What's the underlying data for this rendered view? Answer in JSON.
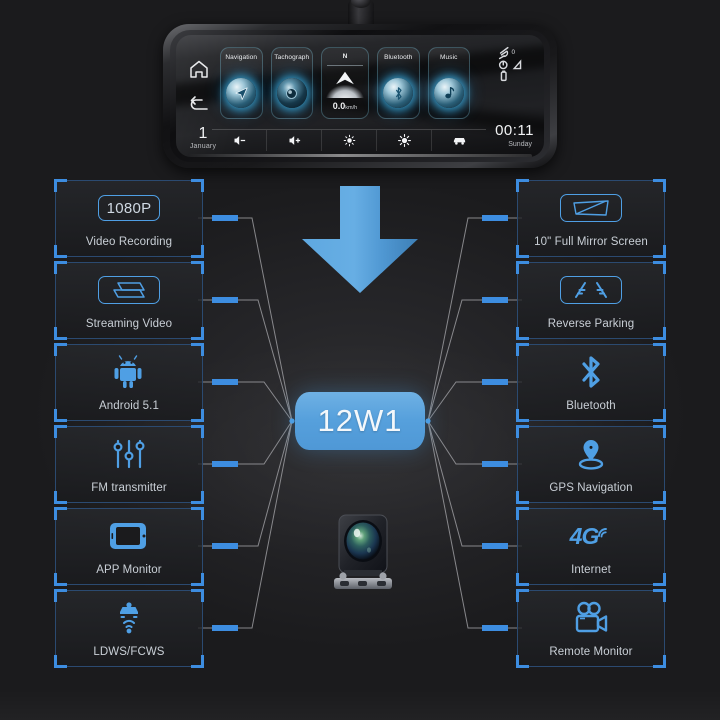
{
  "product": {
    "model_badge": "12W1"
  },
  "mirror": {
    "date_day": "1",
    "date_month": "January",
    "clock_time": "00:11",
    "clock_weekday": "Sunday",
    "home_icon": "home-icon",
    "back_icon": "back-arrow-icon",
    "status_icons": [
      "satellite-icon",
      "sd-card-icon",
      "signal-icon",
      "battery-icon"
    ],
    "satellite_count": "0",
    "speed_tile": {
      "heading": "N",
      "speed_value": "0.0",
      "speed_unit": "km/h",
      "arrow_icon": "compass-arrow-icon"
    },
    "app_tiles": [
      {
        "label": "Navigation",
        "icon": "navigation-arrow-icon"
      },
      {
        "label": "Tachograph",
        "icon": "camera-lens-icon"
      }
    ],
    "app_tiles_right": [
      {
        "label": "Bluetooth",
        "icon": "bluetooth-icon"
      },
      {
        "label": "Music",
        "icon": "music-note-icon"
      }
    ],
    "controls": [
      {
        "name": "volume-down",
        "icon": "volume-minus-icon"
      },
      {
        "name": "volume-up",
        "icon": "volume-plus-icon"
      },
      {
        "name": "brightness-down",
        "icon": "brightness-low-icon"
      },
      {
        "name": "brightness-up",
        "icon": "brightness-high-icon"
      },
      {
        "name": "car-mode",
        "icon": "car-icon"
      }
    ]
  },
  "features_left": [
    {
      "label": "Video Recording",
      "icon": "resolution-1080p-icon",
      "badge_text": "1080P"
    },
    {
      "label": "Streaming Video",
      "icon": "streaming-video-icon",
      "badge_text": ""
    },
    {
      "label": "Android 5.1",
      "icon": "android-robot-icon",
      "badge_text": ""
    },
    {
      "label": "FM transmitter",
      "icon": "sliders-icon",
      "badge_text": ""
    },
    {
      "label": "APP Monitor",
      "icon": "smartphone-icon",
      "badge_text": ""
    },
    {
      "label": "LDWS/FCWS",
      "icon": "car-lane-warning-icon",
      "badge_text": ""
    }
  ],
  "features_right": [
    {
      "label": "10\" Full Mirror Screen",
      "icon": "mirror-screen-icon",
      "badge_text": ""
    },
    {
      "label": "Reverse Parking",
      "icon": "parking-lines-icon",
      "badge_text": ""
    },
    {
      "label": "Bluetooth",
      "icon": "bluetooth-icon",
      "badge_text": ""
    },
    {
      "label": "GPS Navigation",
      "icon": "map-pin-icon",
      "badge_text": ""
    },
    {
      "label": "Internet",
      "icon": "4g-signal-icon",
      "badge_text": "4G"
    },
    {
      "label": "Remote Monitor",
      "icon": "video-camera-icon",
      "badge_text": ""
    }
  ],
  "graphics": {
    "arrow_icon": "down-arrow-icon",
    "rear_camera_icon": "rear-view-camera-icon"
  },
  "colors": {
    "accent_blue": "#4f9fe4",
    "badge_blue": "#56a0dc",
    "card_border": "#2b4a70",
    "bracket_blue": "#3d8de0",
    "background": "#1b1b1d",
    "label_text": "#c9cfd6",
    "connector_line": "#9a9a9e"
  }
}
